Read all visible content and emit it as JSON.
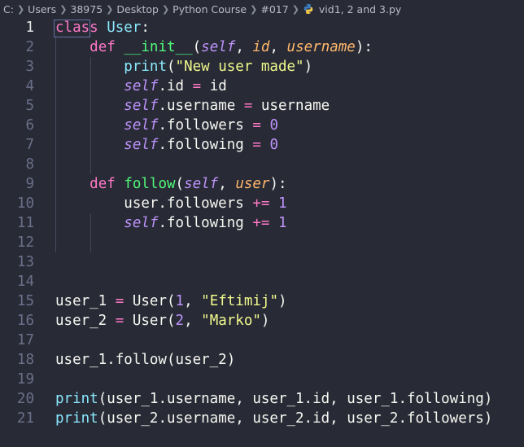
{
  "breadcrumb": {
    "items": [
      "C:",
      "Users",
      "38975",
      "Desktop",
      "Python Course",
      "#017"
    ],
    "file": "vid1, 2 and 3.py"
  },
  "editor": {
    "active_line": 1,
    "lines": [
      {
        "n": "1",
        "tokens": [
          [
            "kw",
            "class"
          ],
          [
            "plain",
            " "
          ],
          [
            "cls",
            "User"
          ],
          [
            "plain",
            ":"
          ]
        ]
      },
      {
        "n": "2",
        "tokens": [
          [
            "plain",
            "    "
          ],
          [
            "kw",
            "def"
          ],
          [
            "plain",
            " "
          ],
          [
            "fn",
            "__init__"
          ],
          [
            "plain",
            "("
          ],
          [
            "self",
            "self"
          ],
          [
            "plain",
            ", "
          ],
          [
            "param",
            "id"
          ],
          [
            "plain",
            ", "
          ],
          [
            "param",
            "username"
          ],
          [
            "plain",
            "):"
          ]
        ]
      },
      {
        "n": "3",
        "tokens": [
          [
            "plain",
            "        "
          ],
          [
            "bi",
            "print"
          ],
          [
            "plain",
            "("
          ],
          [
            "str",
            "\"New user made\""
          ],
          [
            "plain",
            ")"
          ]
        ]
      },
      {
        "n": "4",
        "tokens": [
          [
            "plain",
            "        "
          ],
          [
            "self",
            "self"
          ],
          [
            "plain",
            ".id "
          ],
          [
            "op",
            "="
          ],
          [
            "plain",
            " id"
          ]
        ]
      },
      {
        "n": "5",
        "tokens": [
          [
            "plain",
            "        "
          ],
          [
            "self",
            "self"
          ],
          [
            "plain",
            ".username "
          ],
          [
            "op",
            "="
          ],
          [
            "plain",
            " username"
          ]
        ]
      },
      {
        "n": "6",
        "tokens": [
          [
            "plain",
            "        "
          ],
          [
            "self",
            "self"
          ],
          [
            "plain",
            ".followers "
          ],
          [
            "op",
            "="
          ],
          [
            "plain",
            " "
          ],
          [
            "num",
            "0"
          ]
        ]
      },
      {
        "n": "7",
        "tokens": [
          [
            "plain",
            "        "
          ],
          [
            "self",
            "self"
          ],
          [
            "plain",
            ".following "
          ],
          [
            "op",
            "="
          ],
          [
            "plain",
            " "
          ],
          [
            "num",
            "0"
          ]
        ]
      },
      {
        "n": "8",
        "tokens": []
      },
      {
        "n": "9",
        "tokens": [
          [
            "plain",
            "    "
          ],
          [
            "kw",
            "def"
          ],
          [
            "plain",
            " "
          ],
          [
            "fn",
            "follow"
          ],
          [
            "plain",
            "("
          ],
          [
            "self",
            "self"
          ],
          [
            "plain",
            ", "
          ],
          [
            "param",
            "user"
          ],
          [
            "plain",
            "):"
          ]
        ]
      },
      {
        "n": "10",
        "tokens": [
          [
            "plain",
            "        user.followers "
          ],
          [
            "op",
            "+="
          ],
          [
            "plain",
            " "
          ],
          [
            "num",
            "1"
          ]
        ]
      },
      {
        "n": "11",
        "tokens": [
          [
            "plain",
            "        "
          ],
          [
            "self",
            "self"
          ],
          [
            "plain",
            ".following "
          ],
          [
            "op",
            "+="
          ],
          [
            "plain",
            " "
          ],
          [
            "num",
            "1"
          ]
        ]
      },
      {
        "n": "12",
        "tokens": []
      },
      {
        "n": "13",
        "tokens": []
      },
      {
        "n": "14",
        "tokens": []
      },
      {
        "n": "15",
        "tokens": [
          [
            "plain",
            "user_1 "
          ],
          [
            "op",
            "="
          ],
          [
            "plain",
            " User("
          ],
          [
            "num",
            "1"
          ],
          [
            "plain",
            ", "
          ],
          [
            "str",
            "\"Eftimij\""
          ],
          [
            "plain",
            ")"
          ]
        ]
      },
      {
        "n": "16",
        "tokens": [
          [
            "plain",
            "user_2 "
          ],
          [
            "op",
            "="
          ],
          [
            "plain",
            " User("
          ],
          [
            "num",
            "2"
          ],
          [
            "plain",
            ", "
          ],
          [
            "str",
            "\"Marko\""
          ],
          [
            "plain",
            ")"
          ]
        ]
      },
      {
        "n": "17",
        "tokens": []
      },
      {
        "n": "18",
        "tokens": [
          [
            "plain",
            "user_1.follow(user_2)"
          ]
        ]
      },
      {
        "n": "19",
        "tokens": []
      },
      {
        "n": "20",
        "tokens": [
          [
            "bi",
            "print"
          ],
          [
            "plain",
            "(user_1.username, user_1.id, user_1.following)"
          ]
        ]
      },
      {
        "n": "21",
        "tokens": [
          [
            "bi",
            "print"
          ],
          [
            "plain",
            "(user_2.username, user_2.id, user_2.followers)"
          ]
        ]
      }
    ]
  },
  "colors": {
    "background": "#282a36",
    "keyword": "#ff79c6",
    "class_name": "#8be9fd",
    "function": "#50fa7b",
    "self": "#bd93f9",
    "parameter": "#ffb86c",
    "string": "#f1fa8c",
    "number": "#bd93f9"
  },
  "icons": {
    "file": "python-file-icon",
    "separator": "chevron-right-icon"
  }
}
